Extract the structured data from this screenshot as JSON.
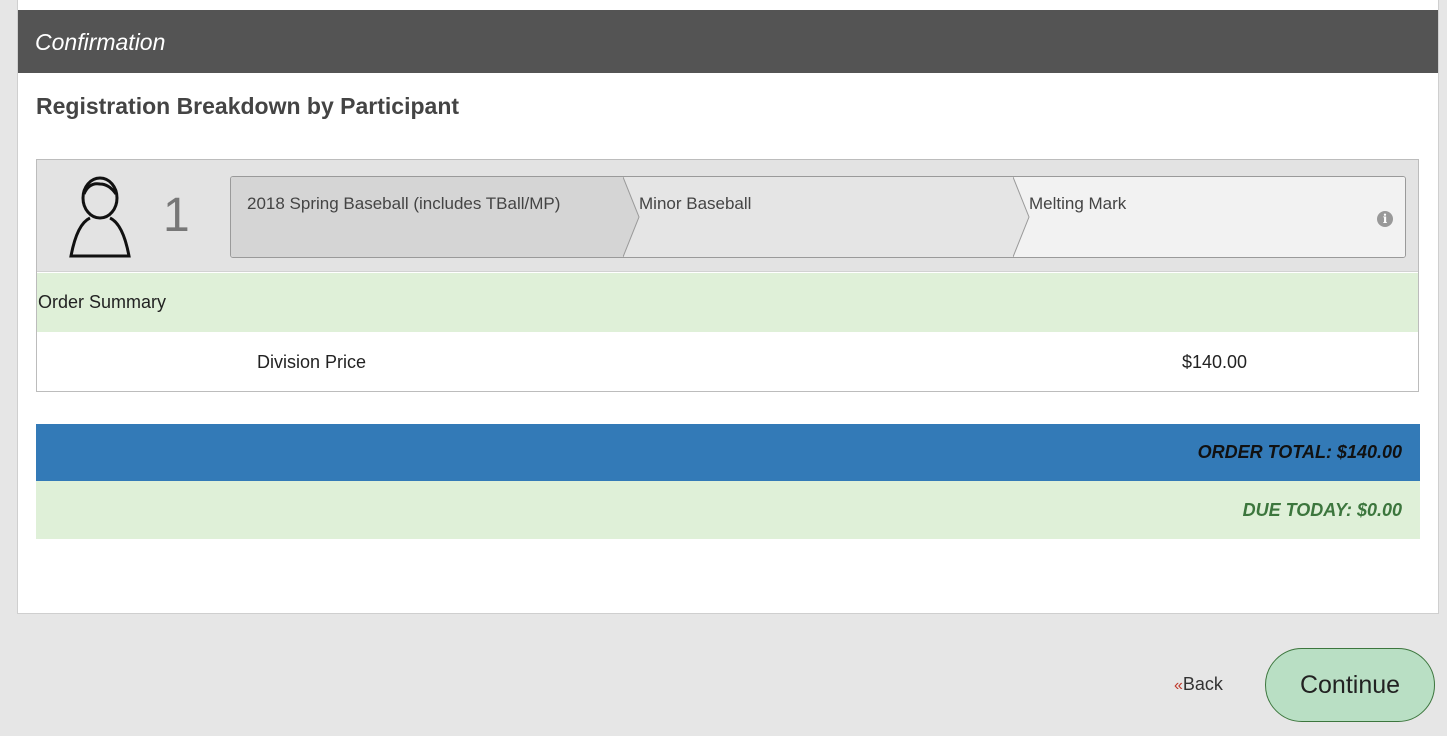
{
  "panel": {
    "header_title": "Confirmation",
    "section_title": "Registration Breakdown by Participant"
  },
  "participant": {
    "number": "1",
    "breadcrumb": [
      {
        "label": "2018 Spring Baseball (includes TBall/MP)"
      },
      {
        "label": "Minor Baseball"
      },
      {
        "label": "Melting Mark"
      }
    ],
    "info_icon": "info-icon"
  },
  "order_summary": {
    "label": "Order Summary",
    "rows": [
      {
        "label": "Division Price",
        "value": "$140.00"
      }
    ]
  },
  "totals": {
    "order_total": "ORDER TOTAL: $140.00",
    "due_today": "DUE TODAY: $0.00"
  },
  "actions": {
    "back_chevron": "«",
    "back_label": "Back",
    "continue_label": "Continue"
  },
  "colors": {
    "header_bg": "#545454",
    "order_total_bg": "#337ab7",
    "success_bg": "#dff0d8",
    "due_today_text": "#3c763d",
    "back_chevron": "#c0392b",
    "continue_bg": "#b9dfc4"
  }
}
